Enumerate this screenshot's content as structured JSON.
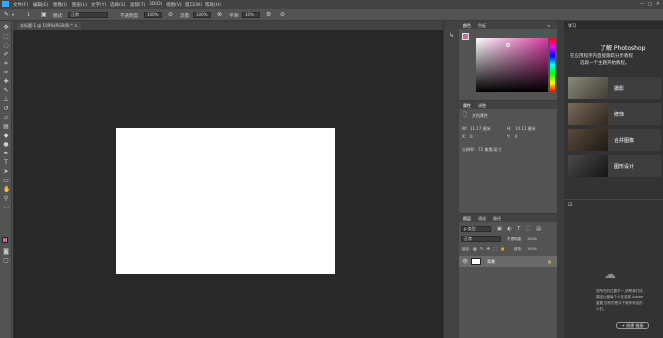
{
  "menubar": {
    "items": [
      "文件(F)",
      "编辑(E)",
      "图像(I)",
      "图层(L)",
      "文字(Y)",
      "选择(S)",
      "滤镜(T)",
      "3D(D)",
      "视图(V)",
      "窗口(W)",
      "帮助(H)"
    ]
  },
  "options": {
    "mode_label": "模式:",
    "mode_value": "正常",
    "opacity_label": "不透明度:",
    "opacity_value": "100%",
    "flow_label": "流量:",
    "flow_value": "100%",
    "smooth_label": "平滑:",
    "smooth_value": "10%",
    "brush_size": "1"
  },
  "document": {
    "tab_title": "未标题-1 @ 100%(RGB/8) *"
  },
  "color_panel": {
    "tabs": [
      "颜色",
      "色板"
    ],
    "accent": "#d63ba3"
  },
  "properties_panel": {
    "tabs": [
      "属性",
      "调整"
    ],
    "section": "文档属性",
    "w_label": "W:",
    "w_value": "11.17 厘米",
    "h_label": "H:",
    "h_value": "14.11 厘米",
    "x_label": "X:",
    "x_value": "0",
    "y_label": "Y:",
    "y_value": "0",
    "resolution": "分辨率：72 像素/英寸"
  },
  "layers_panel": {
    "tabs": [
      "图层",
      "通道",
      "路径"
    ],
    "filter_label": "ρ 类型",
    "blend_mode": "正常",
    "opacity_label": "不透明度:",
    "opacity_value": "100%",
    "lock_label": "锁定:",
    "fill_label": "填充:",
    "fill_value": "100%",
    "layer_name": "背景"
  },
  "learn_panel": {
    "tab": "学习",
    "title": "了解 Photoshop",
    "desc_line1": "在应用程序内直接跟踪分步教程",
    "desc_line2": "后面",
    "desc_line3": "选取一个主题开始教程。",
    "cards": [
      "摄影",
      "修饰",
      "合并图像",
      "图形设计"
    ],
    "bottom_text_line1": "您所在的位置不一,请帮我们找",
    "bottom_text_line2": "原因以使每个人在选择 Adobe",
    "bottom_text_line3": "重要,您有的是对于服务来给的",
    "bottom_text_line4": "人们。",
    "create_button": "+ 创建 链接"
  }
}
